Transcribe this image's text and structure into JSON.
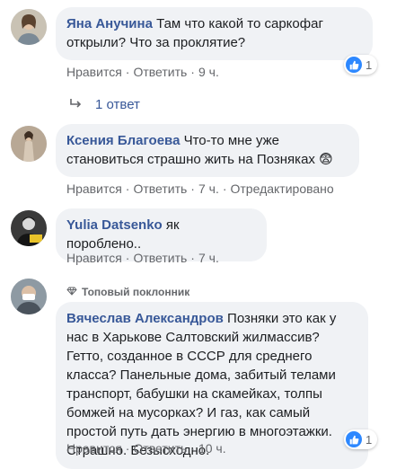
{
  "colors": {
    "bubble_bg": "#f0f2f5",
    "author": "#385898",
    "meta": "#65676b",
    "like": "#2d88ff"
  },
  "actions": {
    "like_label": "Нравится",
    "reply_label": "Ответить",
    "separator": "·"
  },
  "comments": [
    {
      "author": "Яна Анучина",
      "text": "Там что какой то саркофаг открыли? Что за проклятие?",
      "time": "9 ч.",
      "reaction_icon": "like-icon",
      "reaction_count": "1",
      "replies_label": "1 ответ"
    },
    {
      "author": "Ксения Благоева",
      "text": "Что-то мне уже становиться страшно жить на Позняках 😨",
      "time": "7 ч.",
      "edited": "Отредактировано"
    },
    {
      "author": "Yulia Datsenko",
      "text": "як пороблено..",
      "time": "7 ч."
    },
    {
      "badge_icon": "diamond-icon",
      "badge": "Топовый поклонник",
      "author": "Вячеслав Александров",
      "text": "Позняки это как у нас в Харькове Салтовский жилмассив? Гетто, созданное в СССР для среднего класса? Панельные дома, забитый телами транспорт, бабушки на скамейках, толпы бомжей на мусорках? И газ, как самый простой путь дать энергию в многоэтажки. Страшно. Безысходно.",
      "time": "10 ч.",
      "reaction_icon": "like-icon",
      "reaction_count": "1"
    }
  ]
}
